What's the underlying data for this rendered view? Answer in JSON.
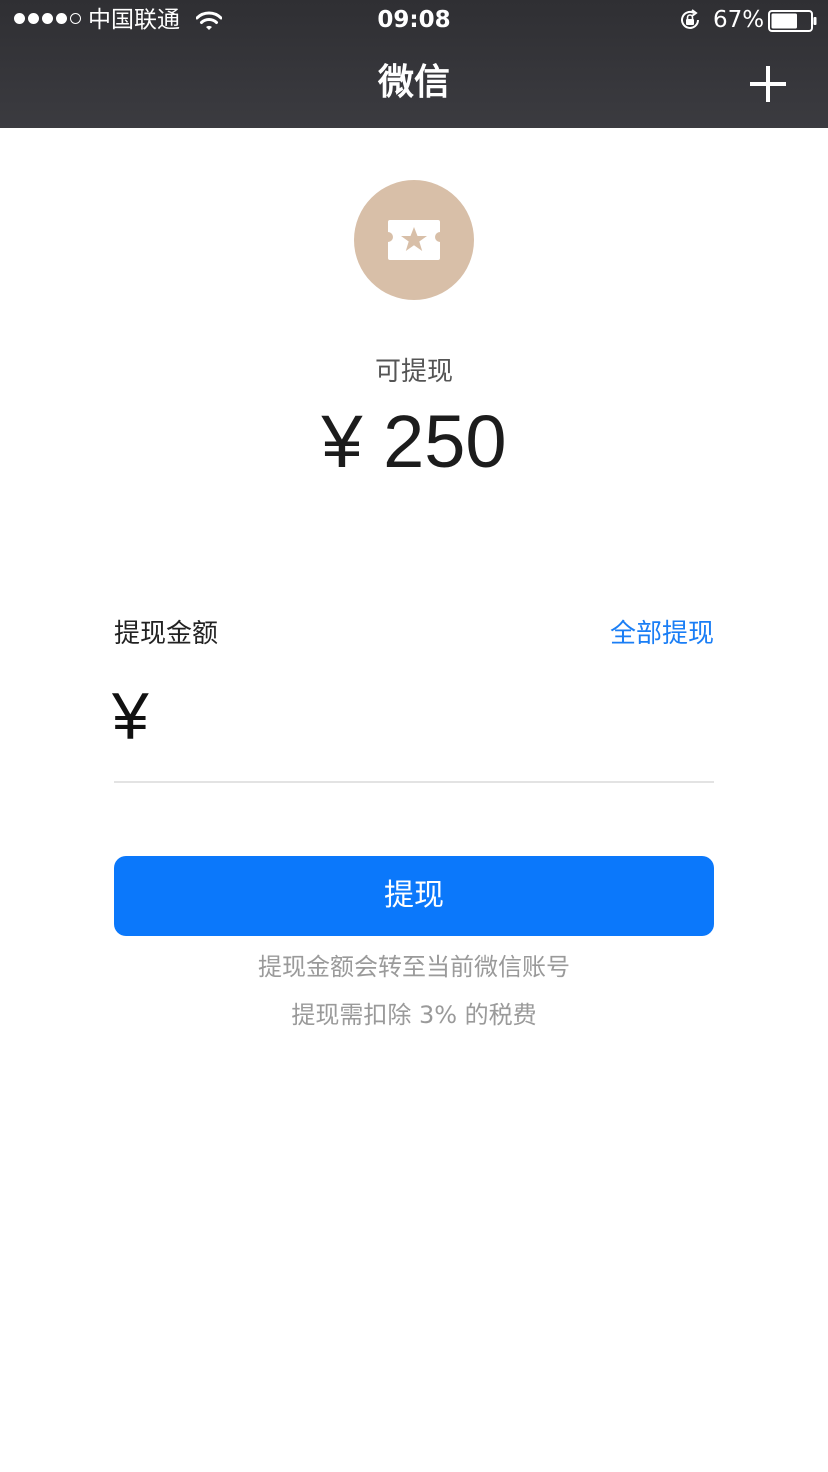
{
  "status_bar": {
    "carrier": "中国联通",
    "time": "09:08",
    "battery_percent": "67%",
    "battery_level": 0.67,
    "signal_bars_filled": 4,
    "signal_bars_total": 5
  },
  "nav": {
    "title": "微信"
  },
  "balance": {
    "label": "可提现",
    "amount": "¥ 250"
  },
  "withdraw_form": {
    "amount_label": "提现金额",
    "withdraw_all_label": "全部提现",
    "currency_symbol": "¥",
    "amount_value": ""
  },
  "actions": {
    "withdraw_label": "提现"
  },
  "notes": {
    "line1": "提现金额会转至当前微信账号",
    "line2": "提现需扣除 3% 的税费"
  },
  "colors": {
    "header_bg": "#36363a",
    "accent_blue": "#0b78fb",
    "link_blue": "#1a7ef5",
    "badge_tan": "#d8bfa8",
    "note_gray": "#9a9a9a"
  },
  "icons": {
    "wifi": "wifi-icon",
    "orientation_lock": "orientation-lock-icon",
    "battery": "battery-icon",
    "add": "plus-icon",
    "coupon": "coupon-star-icon"
  }
}
